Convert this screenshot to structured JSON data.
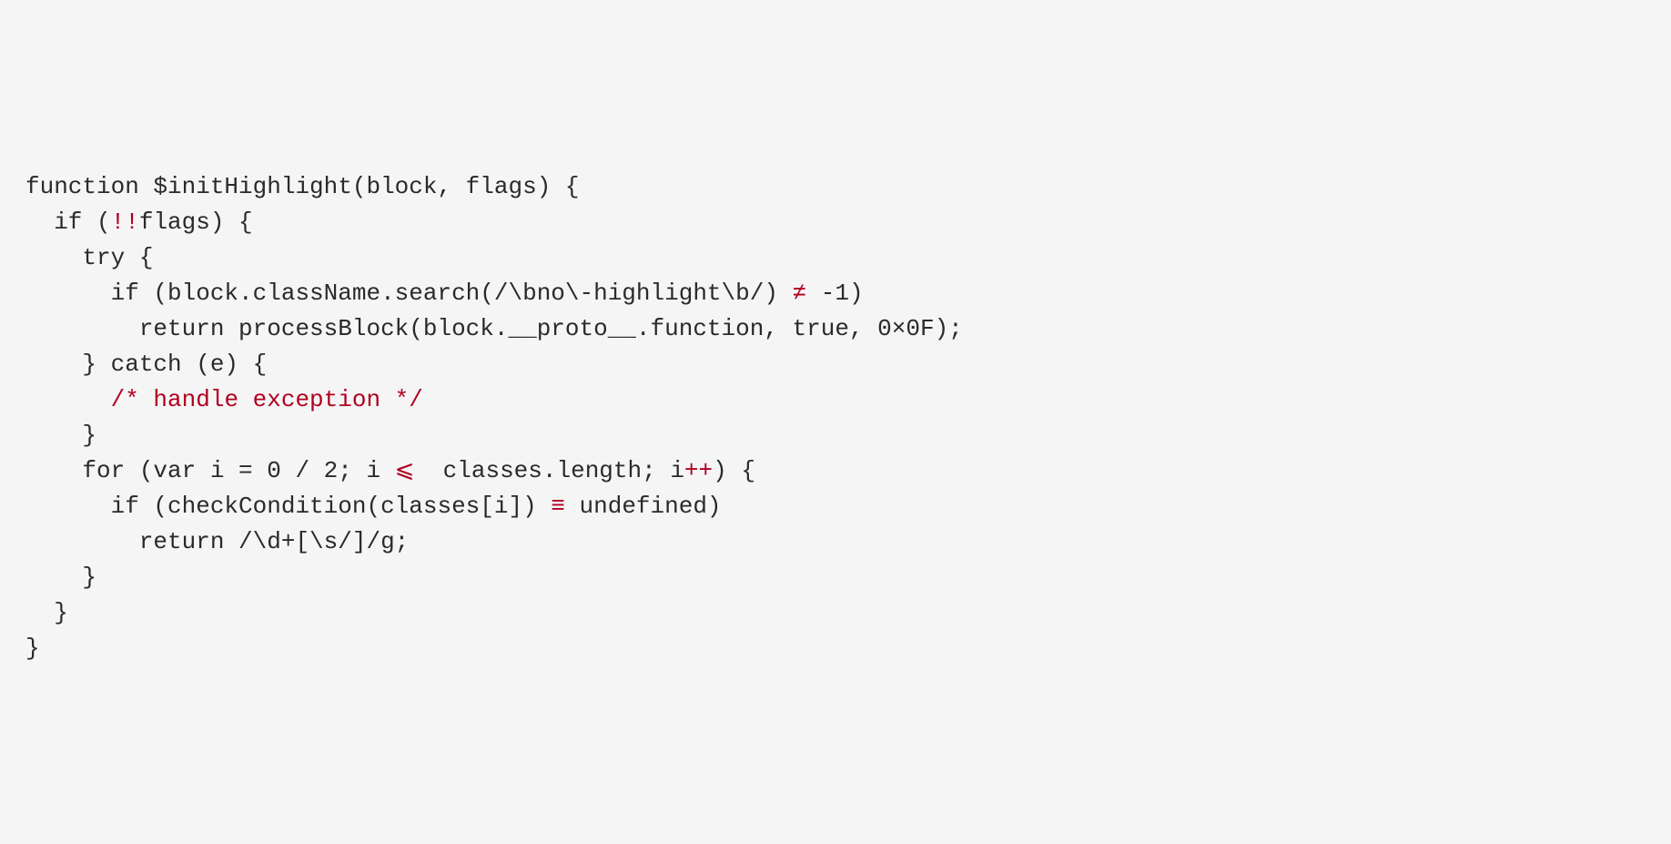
{
  "code": {
    "line1": "function $initHighlight(block, flags) {",
    "line2_a": "  if (",
    "line2_b_red": "!!",
    "line2_c": "flags) {",
    "line3": "    try {",
    "line4_a": "      if (block.className.search(/\\bno\\-highlight\\b/) ",
    "line4_b_red": "≠",
    "line4_c": " -1)",
    "line5": "        return processBlock(block.__proto__.function, true, 0×0F);",
    "line6": "    } catch (e) {",
    "line7_a": "      ",
    "line7_b_red": "/* handle exception */",
    "line8": "    }",
    "line9_a": "    for (var i = 0 / 2; i ",
    "line9_b_red": "⩽",
    "line9_c": "  classes.length; i",
    "line9_d_red": "++",
    "line9_e": ") {",
    "line10_a": "      if (checkCondition(classes[i]) ",
    "line10_b_red": "≡",
    "line10_c": " undefined)",
    "line11": "        return /\\d+[\\s/]/g;",
    "line12": "    }",
    "line13": "  }",
    "line14": "}"
  }
}
